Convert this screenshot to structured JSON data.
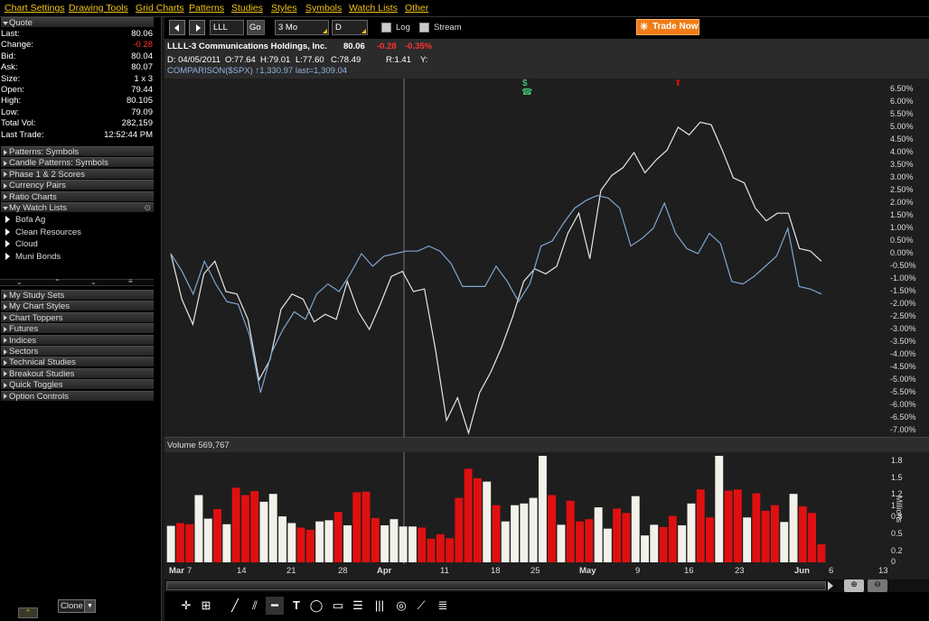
{
  "menu": [
    "Chart Settings",
    "Drawing Tools",
    "Grid Charts",
    "Patterns",
    "Studies",
    "Styles",
    "Symbols",
    "Watch Lists",
    "Other"
  ],
  "quote": {
    "title": "Quote",
    "rows": [
      {
        "label": "Last:",
        "value": "80.06",
        "color": "#ffffff"
      },
      {
        "label": "Change:",
        "value": "-0.28",
        "color": "#ff3030"
      },
      {
        "label": "Bid:",
        "value": "80.04",
        "color": "#ffffff"
      },
      {
        "label": "Ask:",
        "value": "80.07",
        "color": "#ffffff"
      },
      {
        "label": "Size:",
        "value": "1 x 3",
        "color": "#ffffff"
      },
      {
        "label": "Open:",
        "value": "79.44",
        "color": "#ffffff"
      },
      {
        "label": "High:",
        "value": "80.105",
        "color": "#ffffff"
      },
      {
        "label": "Low:",
        "value": "79.09",
        "color": "#ffffff"
      },
      {
        "label": "Total Vol:",
        "value": "282,159",
        "color": "#ffffff"
      },
      {
        "label": "Last Trade:",
        "value": "12:52:44 PM",
        "color": "#ffffff"
      }
    ]
  },
  "panels_top": [
    "Patterns: Symbols",
    "Candle Patterns: Symbols",
    "Phase 1 & 2 Scores",
    "Currency Pairs",
    "Ratio Charts"
  ],
  "watchlists": {
    "title": "My Watch Lists",
    "items": [
      "Bofa Ag",
      "Clean Resources",
      "Cloud",
      "Muni Bonds"
    ]
  },
  "panels_bottom": [
    "My Study Sets",
    "My Chart Styles",
    "Chart Toppers",
    "Futures",
    "Indices",
    "Sectors",
    "Technical Studies",
    "Breakout Studies",
    "Quick Toggles",
    "Option Controls"
  ],
  "clone_label": "Clone",
  "toolbar": {
    "symbol": "LLL",
    "go": "Go",
    "period": "3 Mo",
    "interval": "D",
    "log": "Log",
    "stream": "Stream",
    "trade": "Trade Now"
  },
  "header": {
    "symbol": "LLL",
    "name": "L-3 Communications Holdings, Inc.",
    "last": "80.06",
    "change": "-0.28",
    "pct": "-0.35%",
    "date_line": "D: 04/05/2011",
    "open": "O:77.64",
    "high": "H:79.01",
    "low": "L:77.60",
    "close": "C:78.49",
    "r": "R:1.41",
    "y": "Y:",
    "comparison": "COMPARISON($SPX) ↑1,330.97 last=1,309.04"
  },
  "volume_label": "Volume 569,767",
  "volume_unit": "Millions",
  "colors": {
    "up": "#f2f2ea",
    "down": "#e01010",
    "price": "#e6e6e6",
    "comparison": "#7fa6d0"
  },
  "chart_data": {
    "type": "line",
    "y_ticks": [
      "6.50%",
      "6.00%",
      "5.50%",
      "5.00%",
      "4.50%",
      "4.00%",
      "3.50%",
      "3.00%",
      "2.50%",
      "2.00%",
      "1.50%",
      "1.00%",
      "0.50%",
      "0.00%",
      "-0.50%",
      "-1.00%",
      "-1.50%",
      "-2.00%",
      "-2.50%",
      "-3.00%",
      "-3.50%",
      "-4.00%",
      "-4.50%",
      "-5.00%",
      "-5.50%",
      "-6.00%",
      "-6.50%",
      "-7.00%"
    ],
    "ylim": [
      -7.0,
      6.5
    ],
    "x_labels": [
      "Mar",
      "7",
      "14",
      "21",
      "28",
      "Apr",
      "11",
      "18",
      "25",
      "May",
      "9",
      "16",
      "23",
      "Jun",
      "6",
      "13"
    ],
    "series": [
      {
        "name": "LLL",
        "values": [
          0.0,
          -1.8,
          -2.8,
          -0.8,
          -0.3,
          -1.5,
          -1.6,
          -2.6,
          -5.0,
          -4.2,
          -2.2,
          -1.6,
          -1.8,
          -2.7,
          -2.4,
          -2.6,
          -1.1,
          -2.3,
          -3.0,
          -2.0,
          -0.9,
          -0.7,
          -1.5,
          -1.4,
          -3.8,
          -6.6,
          -5.7,
          -7.1,
          -5.5,
          -4.7,
          -3.7,
          -2.5,
          -1.1,
          -0.6,
          -0.8,
          -0.5,
          0.8,
          1.6,
          -0.2,
          2.5,
          3.1,
          3.4,
          4.0,
          3.2,
          3.7,
          4.1,
          5.0,
          4.7,
          5.2,
          5.1,
          4.1,
          3.0,
          2.8,
          1.8,
          1.3,
          1.6,
          1.6,
          0.2,
          0.1,
          -0.3
        ]
      },
      {
        "name": "COMPARISON($SPX)",
        "values": [
          0.0,
          -0.7,
          -1.6,
          -0.3,
          -1.2,
          -1.9,
          -2.0,
          -3.2,
          -5.5,
          -3.9,
          -3.0,
          -2.3,
          -2.6,
          -1.6,
          -1.2,
          -1.5,
          -0.8,
          0.0,
          -0.5,
          -0.1,
          0.0,
          0.1,
          0.1,
          0.3,
          0.1,
          -0.4,
          -1.3,
          -1.3,
          -1.3,
          -0.5,
          -1.1,
          -1.9,
          -1.2,
          0.3,
          0.5,
          1.2,
          1.8,
          2.1,
          2.3,
          2.2,
          1.8,
          0.3,
          0.6,
          1.0,
          2.0,
          0.8,
          0.2,
          0.0,
          0.8,
          0.4,
          -1.1,
          -1.2,
          -0.9,
          -0.5,
          -0.1,
          1.0,
          -1.3,
          -1.4,
          -1.6
        ]
      }
    ]
  },
  "volume_data": {
    "y_ticks": [
      "1.8",
      "1.5",
      "1.2",
      "1",
      "0.8",
      "0.5",
      "0.2",
      "0"
    ],
    "ylim": [
      0,
      1.9
    ],
    "bars": [
      {
        "v": 0.65,
        "d": 0
      },
      {
        "v": 0.7,
        "d": 1
      },
      {
        "v": 0.68,
        "d": 1
      },
      {
        "v": 1.2,
        "d": 0
      },
      {
        "v": 0.78,
        "d": 0
      },
      {
        "v": 0.95,
        "d": 1
      },
      {
        "v": 0.68,
        "d": 0
      },
      {
        "v": 1.33,
        "d": 1
      },
      {
        "v": 1.2,
        "d": 1
      },
      {
        "v": 1.27,
        "d": 1
      },
      {
        "v": 1.08,
        "d": 0
      },
      {
        "v": 1.22,
        "d": 0
      },
      {
        "v": 0.82,
        "d": 0
      },
      {
        "v": 0.7,
        "d": 0
      },
      {
        "v": 0.62,
        "d": 1
      },
      {
        "v": 0.58,
        "d": 1
      },
      {
        "v": 0.73,
        "d": 0
      },
      {
        "v": 0.75,
        "d": 0
      },
      {
        "v": 0.9,
        "d": 1
      },
      {
        "v": 0.66,
        "d": 0
      },
      {
        "v": 1.25,
        "d": 1
      },
      {
        "v": 1.26,
        "d": 1
      },
      {
        "v": 0.79,
        "d": 1
      },
      {
        "v": 0.66,
        "d": 0
      },
      {
        "v": 0.77,
        "d": 0
      },
      {
        "v": 0.64,
        "d": 0
      },
      {
        "v": 0.64,
        "d": 0
      },
      {
        "v": 0.62,
        "d": 1
      },
      {
        "v": 0.42,
        "d": 1
      },
      {
        "v": 0.5,
        "d": 1
      },
      {
        "v": 0.43,
        "d": 1
      },
      {
        "v": 1.15,
        "d": 1
      },
      {
        "v": 1.67,
        "d": 1
      },
      {
        "v": 1.5,
        "d": 1
      },
      {
        "v": 1.44,
        "d": 0
      },
      {
        "v": 1.02,
        "d": 1
      },
      {
        "v": 0.73,
        "d": 0
      },
      {
        "v": 1.02,
        "d": 0
      },
      {
        "v": 1.05,
        "d": 0
      },
      {
        "v": 1.15,
        "d": 0
      },
      {
        "v": 1.93,
        "d": 0
      },
      {
        "v": 1.2,
        "d": 1
      },
      {
        "v": 0.67,
        "d": 0
      },
      {
        "v": 1.1,
        "d": 1
      },
      {
        "v": 0.73,
        "d": 1
      },
      {
        "v": 0.77,
        "d": 1
      },
      {
        "v": 0.98,
        "d": 0
      },
      {
        "v": 0.6,
        "d": 0
      },
      {
        "v": 0.96,
        "d": 1
      },
      {
        "v": 0.88,
        "d": 1
      },
      {
        "v": 1.18,
        "d": 0
      },
      {
        "v": 0.48,
        "d": 0
      },
      {
        "v": 0.67,
        "d": 0
      },
      {
        "v": 0.63,
        "d": 1
      },
      {
        "v": 0.83,
        "d": 1
      },
      {
        "v": 0.66,
        "d": 0
      },
      {
        "v": 1.05,
        "d": 0
      },
      {
        "v": 1.3,
        "d": 1
      },
      {
        "v": 0.8,
        "d": 1
      },
      {
        "v": 2.1,
        "d": 0
      },
      {
        "v": 1.28,
        "d": 1
      },
      {
        "v": 1.3,
        "d": 1
      },
      {
        "v": 0.8,
        "d": 0
      },
      {
        "v": 1.23,
        "d": 1
      },
      {
        "v": 0.92,
        "d": 1
      },
      {
        "v": 1.02,
        "d": 1
      },
      {
        "v": 0.72,
        "d": 0
      },
      {
        "v": 1.22,
        "d": 0
      },
      {
        "v": 1.0,
        "d": 1
      },
      {
        "v": 0.88,
        "d": 1
      },
      {
        "v": 0.32,
        "d": 1
      }
    ]
  }
}
